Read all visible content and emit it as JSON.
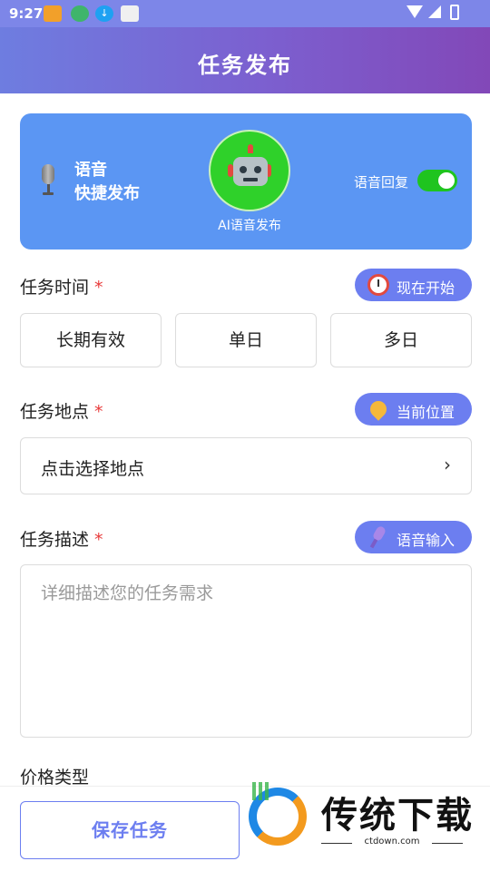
{
  "status_bar": {
    "time": "9:27",
    "notification_icons": [
      "app-icon",
      "leaf-icon",
      "download-icon",
      "image-icon"
    ]
  },
  "header": {
    "title": "任务发布"
  },
  "voice_card": {
    "label_line1": "语音",
    "label_line2": "快捷发布",
    "ai_label": "AI语音发布",
    "reply_label": "语音回复",
    "reply_enabled": true
  },
  "task_time": {
    "label": "任务时间",
    "required_mark": "*",
    "action": "现在开始",
    "options": [
      "长期有效",
      "单日",
      "多日"
    ]
  },
  "task_location": {
    "label": "任务地点",
    "required_mark": "*",
    "action": "当前位置",
    "select_text": "点击选择地点",
    "chevron": "›"
  },
  "task_description": {
    "label": "任务描述",
    "required_mark": "*",
    "action": "语音输入",
    "placeholder": "详细描述您的任务需求"
  },
  "price_type": {
    "label": "价格类型"
  },
  "bottom": {
    "save_label": "保存任务"
  },
  "watermark": {
    "title": "传统下载",
    "url": "ctdown.com"
  },
  "colors": {
    "header_gradient_start": "#6e7de0",
    "header_gradient_end": "#8248b8",
    "voice_card": "#5b96f3",
    "accent": "#6c7ef0",
    "toggle_on": "#1fc41f",
    "required": "#e83a3a"
  }
}
